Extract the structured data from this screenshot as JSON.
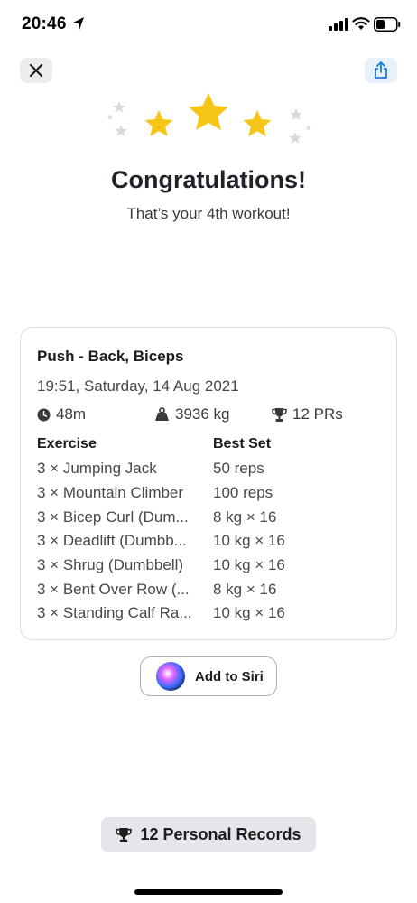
{
  "status_bar": {
    "time": "20:46",
    "icons": [
      "location-arrow-icon",
      "cellular-signal-icon",
      "wifi-icon",
      "battery-icon"
    ]
  },
  "header": {
    "close_icon": "close-icon",
    "share_icon": "share-icon"
  },
  "celebration": {
    "title": "Congratulations!",
    "subtitle": "That’s your 4th workout!",
    "star_color": "#f5c518"
  },
  "workout": {
    "name": "Push - Back, Biceps",
    "date": "19:51, Saturday, 14 Aug 2021",
    "duration": "48m",
    "volume": "3936 kg",
    "prs": "12 PRs",
    "columns": {
      "exercise": "Exercise",
      "best_set": "Best Set"
    },
    "exercises": [
      {
        "name": "3 × Jumping Jack",
        "best": "50 reps"
      },
      {
        "name": "3 × Mountain Climber",
        "best": "100 reps"
      },
      {
        "name": "3 × Bicep Curl (Dum...",
        "best": "8 kg × 16"
      },
      {
        "name": "3 × Deadlift (Dumbb...",
        "best": "10 kg × 16"
      },
      {
        "name": "3 × Shrug (Dumbbell)",
        "best": "10 kg × 16"
      },
      {
        "name": "3 × Bent Over Row (...",
        "best": "8 kg × 16"
      },
      {
        "name": "3 × Standing Calf Ra...",
        "best": "10 kg × 16"
      }
    ]
  },
  "siri": {
    "label": "Add to Siri"
  },
  "personal_records": {
    "label": "12 Personal Records"
  },
  "colors": {
    "accent": "#1a7ce0",
    "star": "#f5c518",
    "muted_star": "#d9d9dc"
  }
}
